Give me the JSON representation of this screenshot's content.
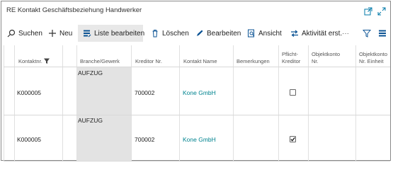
{
  "window": {
    "title": "RE Kontakt Geschäftsbeziehung Handwerker"
  },
  "toolbar": {
    "search_label": "Suchen",
    "new_label": "Neu",
    "edit_list_label": "Liste bearbeiten",
    "delete_label": "Löschen",
    "edit_label": "Bearbeiten",
    "view_label": "Ansicht",
    "activity_label": "Aktivität erst.",
    "more_label": "···"
  },
  "table": {
    "headers": {
      "contact_no": "Kontaktnr.",
      "branch": "Branche/Gewerk",
      "creditor_no": "Kreditor Nr.",
      "contact_name": "Kontakt Name",
      "remarks": "Bemerkungen",
      "mandatory_creditor_1": "Pflicht-",
      "mandatory_creditor_2": "Kreditor",
      "object_account_1": "Objektkonto",
      "object_account_2": "Nr.",
      "object_account_unit_1": "Objektkonto",
      "object_account_unit_2": "Nr. Einheit"
    },
    "rows": [
      {
        "contact_no": "K000005",
        "branch": "AUFZUG",
        "creditor_no": "700002",
        "contact_name": "Kone GmbH",
        "remarks": "",
        "mandatory_creditor": false
      },
      {
        "contact_no": "K000005",
        "branch": "AUFZUG",
        "creditor_no": "700002",
        "contact_name": "Kone GmbH",
        "remarks": "",
        "mandatory_creditor": true
      }
    ]
  },
  "colors": {
    "link": "#00838f",
    "active_button_bg": "#e8e8e8",
    "shaded_column": "#e3e3e3"
  }
}
